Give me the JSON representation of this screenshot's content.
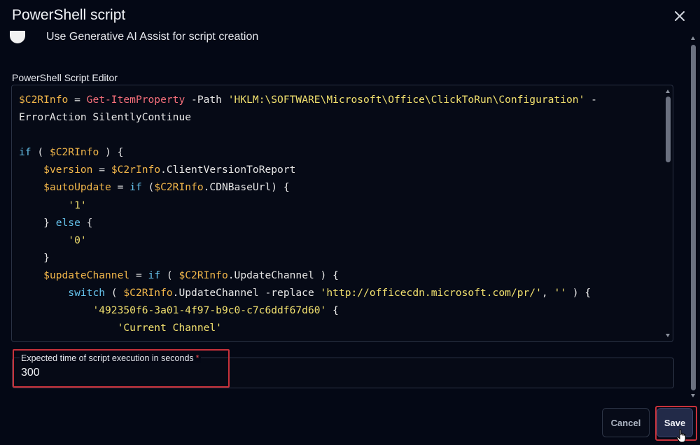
{
  "dialog": {
    "title": "PowerShell script",
    "gen_ai_label": "Use Generative AI Assist for script creation",
    "editor_label": "PowerShell Script Editor",
    "code_lines": [
      [
        {
          "t": "$C2RInfo",
          "c": "var"
        },
        {
          "t": " = ",
          "c": "plain"
        },
        {
          "t": "Get-ItemProperty",
          "c": "cmd"
        },
        {
          "t": " -Path ",
          "c": "plain"
        },
        {
          "t": "'HKLM:\\SOFTWARE\\Microsoft\\Office\\ClickToRun\\Configuration'",
          "c": "str"
        },
        {
          "t": " -",
          "c": "plain"
        }
      ],
      [
        {
          "t": "ErrorAction SilentlyContinue",
          "c": "plain"
        }
      ],
      [],
      [
        {
          "t": "if",
          "c": "kw"
        },
        {
          "t": " ( ",
          "c": "plain"
        },
        {
          "t": "$C2RInfo",
          "c": "var"
        },
        {
          "t": " ) {",
          "c": "plain"
        }
      ],
      [
        {
          "t": "    ",
          "c": "plain"
        },
        {
          "t": "$version",
          "c": "var"
        },
        {
          "t": " = ",
          "c": "plain"
        },
        {
          "t": "$C2rInfo",
          "c": "var"
        },
        {
          "t": ".ClientVersionToReport",
          "c": "plain"
        }
      ],
      [
        {
          "t": "    ",
          "c": "plain"
        },
        {
          "t": "$autoUpdate",
          "c": "var"
        },
        {
          "t": " = ",
          "c": "plain"
        },
        {
          "t": "if",
          "c": "kw"
        },
        {
          "t": " (",
          "c": "plain"
        },
        {
          "t": "$C2RInfo",
          "c": "var"
        },
        {
          "t": ".CDNBaseUrl) {",
          "c": "plain"
        }
      ],
      [
        {
          "t": "        ",
          "c": "plain"
        },
        {
          "t": "'1'",
          "c": "str"
        }
      ],
      [
        {
          "t": "    } ",
          "c": "plain"
        },
        {
          "t": "else",
          "c": "kw"
        },
        {
          "t": " {",
          "c": "plain"
        }
      ],
      [
        {
          "t": "        ",
          "c": "plain"
        },
        {
          "t": "'0'",
          "c": "str"
        }
      ],
      [
        {
          "t": "    }",
          "c": "plain"
        }
      ],
      [
        {
          "t": "    ",
          "c": "plain"
        },
        {
          "t": "$updateChannel",
          "c": "var"
        },
        {
          "t": " = ",
          "c": "plain"
        },
        {
          "t": "if",
          "c": "kw"
        },
        {
          "t": " ( ",
          "c": "plain"
        },
        {
          "t": "$C2RInfo",
          "c": "var"
        },
        {
          "t": ".UpdateChannel ) {",
          "c": "plain"
        }
      ],
      [
        {
          "t": "        ",
          "c": "plain"
        },
        {
          "t": "switch",
          "c": "kw"
        },
        {
          "t": " ( ",
          "c": "plain"
        },
        {
          "t": "$C2RInfo",
          "c": "var"
        },
        {
          "t": ".UpdateChannel -replace ",
          "c": "plain"
        },
        {
          "t": "'http://officecdn.microsoft.com/pr/'",
          "c": "str"
        },
        {
          "t": ", ",
          "c": "plain"
        },
        {
          "t": "''",
          "c": "str"
        },
        {
          "t": " ) {",
          "c": "plain"
        }
      ],
      [
        {
          "t": "            ",
          "c": "plain"
        },
        {
          "t": "'492350f6-3a01-4f97-b9c0-c7c6ddf67d60'",
          "c": "str"
        },
        {
          "t": " {",
          "c": "plain"
        }
      ],
      [
        {
          "t": "                ",
          "c": "plain"
        },
        {
          "t": "'Current Channel'",
          "c": "str"
        }
      ]
    ],
    "exec_label": "Expected time of script execution in seconds",
    "exec_required_mark": "*",
    "exec_value": "300",
    "cancel_label": "Cancel",
    "save_label": "Save"
  },
  "icons": {
    "close": "close-icon",
    "toggle": "toggle-knob",
    "cursor": "cursor-hand-icon"
  },
  "colors": {
    "background": "#040815",
    "highlight": "#c8323b",
    "variable": "#f2b74a",
    "cmdlet": "#f46f7a",
    "string": "#f1e06e",
    "keyword": "#66c3ec"
  }
}
